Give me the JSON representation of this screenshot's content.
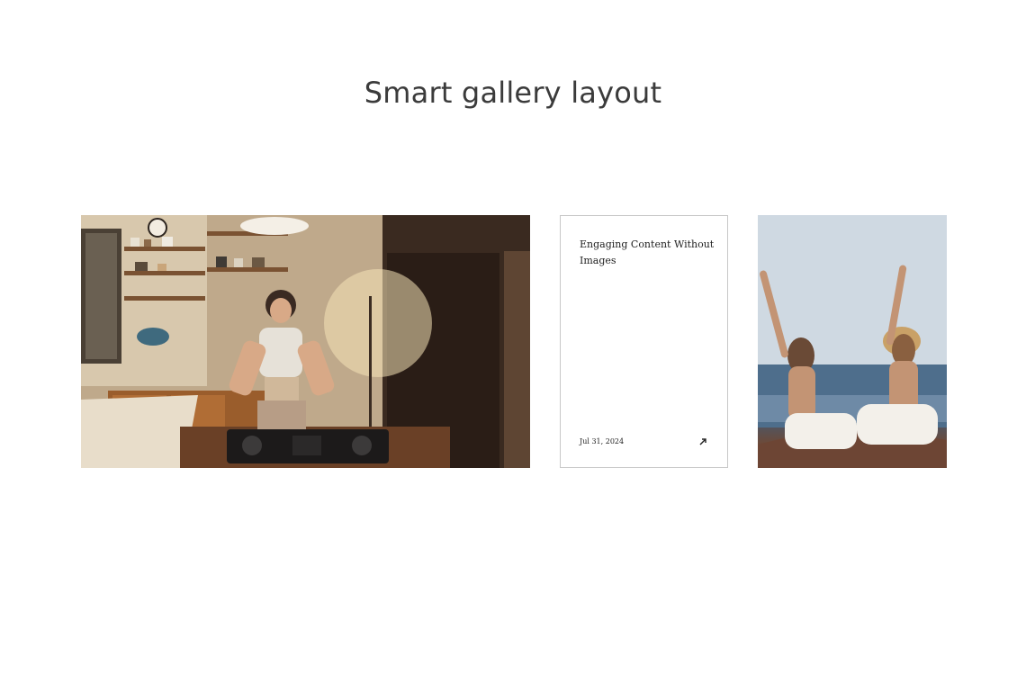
{
  "page": {
    "title": "Smart gallery layout"
  },
  "gallery": {
    "items": [
      {
        "kind": "photo",
        "image_name": "dj-in-kitchen-photo"
      },
      {
        "kind": "text-card",
        "title": "Engaging Content Without Images",
        "date": "Jul 31, 2024",
        "icon": "arrow-up-right-icon"
      },
      {
        "kind": "photo",
        "image_name": "beach-women-photo"
      }
    ]
  },
  "colors": {
    "title_text": "#3b3b3b",
    "card_border": "#c8c8c8",
    "card_text": "#222222",
    "background": "#ffffff"
  }
}
